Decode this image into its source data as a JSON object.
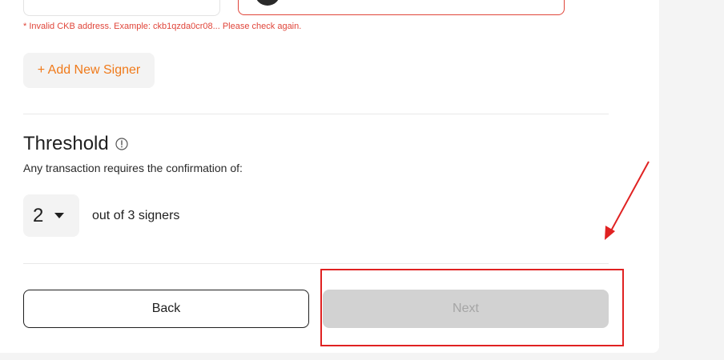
{
  "signers": {
    "error_message": "* Invalid CKB address. Example: ckb1qzda0cr08... Please check again.",
    "add_button_label": "+ Add New Signer"
  },
  "threshold": {
    "title": "Threshold",
    "info_icon": "info-circle-icon",
    "description": "Any transaction requires the confirmation of:",
    "selected_value": "2",
    "suffix": "out of 3 signers"
  },
  "actions": {
    "back_label": "Back",
    "next_label": "Next",
    "next_disabled": true
  },
  "annotation": {
    "color": "#e02222"
  },
  "colors": {
    "accent": "#f07a1a",
    "error": "#e0453a",
    "disabled_bg": "#d2d2d2",
    "disabled_text": "#a5a5a5"
  }
}
